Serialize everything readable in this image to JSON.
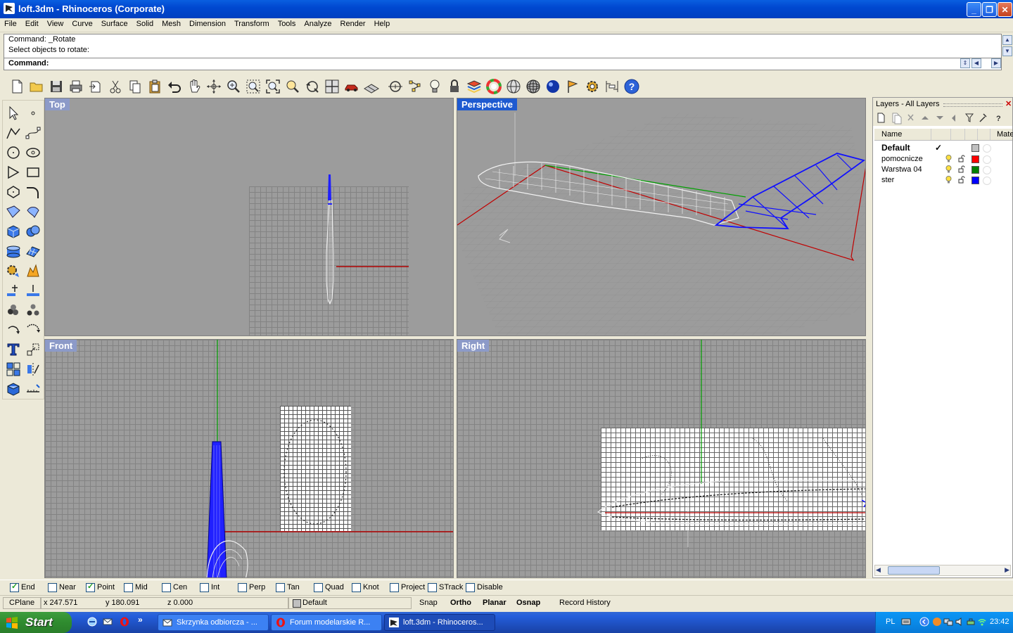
{
  "window": {
    "title": "loft.3dm - Rhinoceros (Corporate)",
    "minimize": "_",
    "restore": "❐",
    "close": "✕"
  },
  "menu": [
    "File",
    "Edit",
    "View",
    "Curve",
    "Surface",
    "Solid",
    "Mesh",
    "Dimension",
    "Transform",
    "Tools",
    "Analyze",
    "Render",
    "Help"
  ],
  "command": {
    "history": [
      "Command: _Rotate",
      "Select objects to rotate:"
    ],
    "prompt": "Command:",
    "value": ""
  },
  "viewports": {
    "top": "Top",
    "perspective": "Perspective",
    "front": "Front",
    "right": "Right"
  },
  "layers": {
    "title": "Layers - All Layers",
    "columns": {
      "name": "Name",
      "material": "Mate"
    },
    "rows": [
      {
        "name": "Default",
        "current": true,
        "color": "#C0C0C0"
      },
      {
        "name": "pomocnicze",
        "current": false,
        "color": "#FF0000"
      },
      {
        "name": "Warstwa 04",
        "current": false,
        "color": "#008000"
      },
      {
        "name": "ster",
        "current": false,
        "color": "#0000FF"
      }
    ],
    "current_mark": "✓"
  },
  "osnap": [
    {
      "label": "End",
      "checked": true
    },
    {
      "label": "Near",
      "checked": false
    },
    {
      "label": "Point",
      "checked": true
    },
    {
      "label": "Mid",
      "checked": false
    },
    {
      "label": "Cen",
      "checked": false
    },
    {
      "label": "Int",
      "checked": false
    },
    {
      "label": "Perp",
      "checked": false
    },
    {
      "label": "Tan",
      "checked": false
    },
    {
      "label": "Quad",
      "checked": false
    },
    {
      "label": "Knot",
      "checked": false
    },
    {
      "label": "Project",
      "checked": false
    },
    {
      "label": "STrack",
      "checked": false
    },
    {
      "label": "Disable",
      "checked": false
    }
  ],
  "status": {
    "cplane": "CPlane",
    "x": "x 247.571",
    "y": "y 180.091",
    "z": "z 0.000",
    "layer": "Default",
    "snap": "Snap",
    "ortho": "Ortho",
    "planar": "Planar",
    "osnap": "Osnap",
    "record_history": "Record History"
  },
  "taskbar": {
    "start": "Start",
    "tasks": [
      {
        "label": "Skrzynka odbiorcza - ...",
        "active": false
      },
      {
        "label": "Forum modelarskie R...",
        "active": false
      },
      {
        "label": "loft.3dm - Rhinoceros...",
        "active": true
      }
    ],
    "quicklaunch_more": "»",
    "lang": "PL",
    "time": "23:42"
  },
  "icons": {
    "toolbar": [
      "new-file-icon",
      "open-folder-icon",
      "save-icon",
      "print-icon",
      "import-icon",
      "cut-icon",
      "copy-icon",
      "paste-icon",
      "undo-icon",
      "pan-icon",
      "rotate-view-icon",
      "zoom-icon",
      "zoom-window-icon",
      "zoom-extents-icon",
      "zoom-selected-icon",
      "undo-view-icon",
      "four-viewports-icon",
      "car-shade-icon",
      "plane-render-icon",
      "snap-point-icon",
      "select-points-icon",
      "lightbulb-icon",
      "lock-icon",
      "layer-icon",
      "color-wheel-icon",
      "wireframe-sphere-icon",
      "mesh-sphere-icon",
      "render-sphere-icon",
      "flag-icon",
      "options-gear-icon",
      "dimension-icon",
      "help-icon"
    ]
  },
  "colors": {
    "viewport_bg": "#9C9C9C",
    "active_title": "#1E5AD0",
    "inactive_title": "#8C9AC8",
    "x_axis": "#B00000",
    "y_axis": "#00A000",
    "wire": "#F0F0F0",
    "tail": "#0000FF"
  }
}
